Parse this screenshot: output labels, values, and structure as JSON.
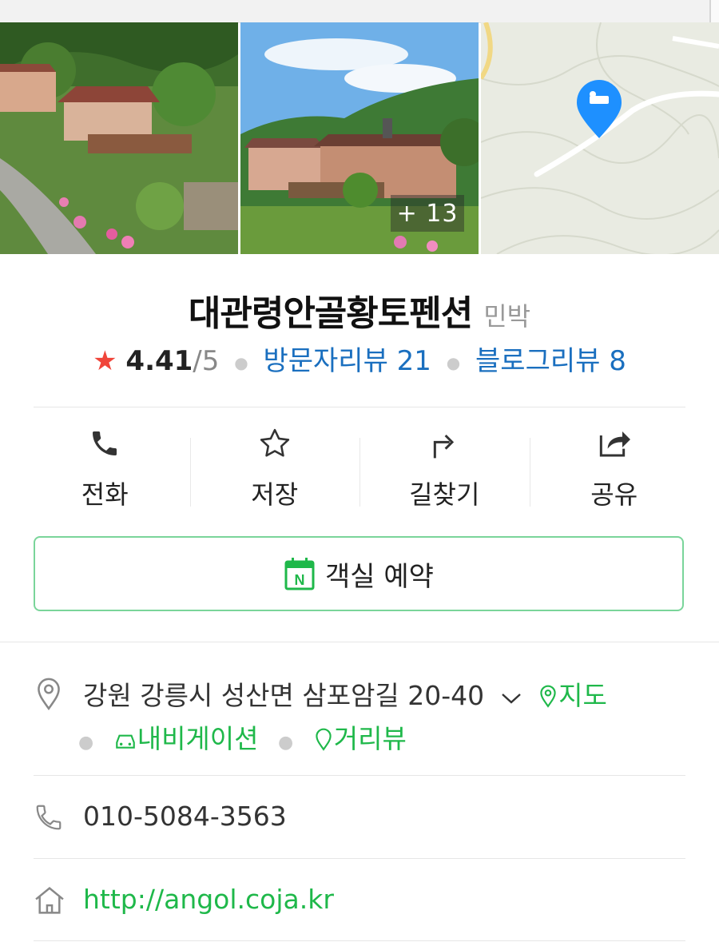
{
  "gallery": {
    "more_count": "+ 13"
  },
  "place": {
    "name": "대관령안골황토펜션",
    "category": "민박"
  },
  "rating": {
    "star": "★",
    "score": "4.41",
    "max": "/5",
    "visitor_reviews": "방문자리뷰 21",
    "blog_reviews": "블로그리뷰 8"
  },
  "actions": {
    "call": "전화",
    "save": "저장",
    "directions": "길찾기",
    "share": "공유"
  },
  "reserve": {
    "label": "객실 예약"
  },
  "address": {
    "text": "강원 강릉시 성산면 삼포암길 20-40",
    "map": "지도",
    "navigation": "내비게이션",
    "street_view": "거리뷰"
  },
  "phone": {
    "number": "010-5084-3563"
  },
  "website": {
    "url": "http://angol.coja.kr"
  },
  "colors": {
    "accent_green": "#1fb84a",
    "link_blue": "#1a6fbf",
    "star_red": "#f0453a",
    "map_pin_blue": "#1e90ff"
  }
}
